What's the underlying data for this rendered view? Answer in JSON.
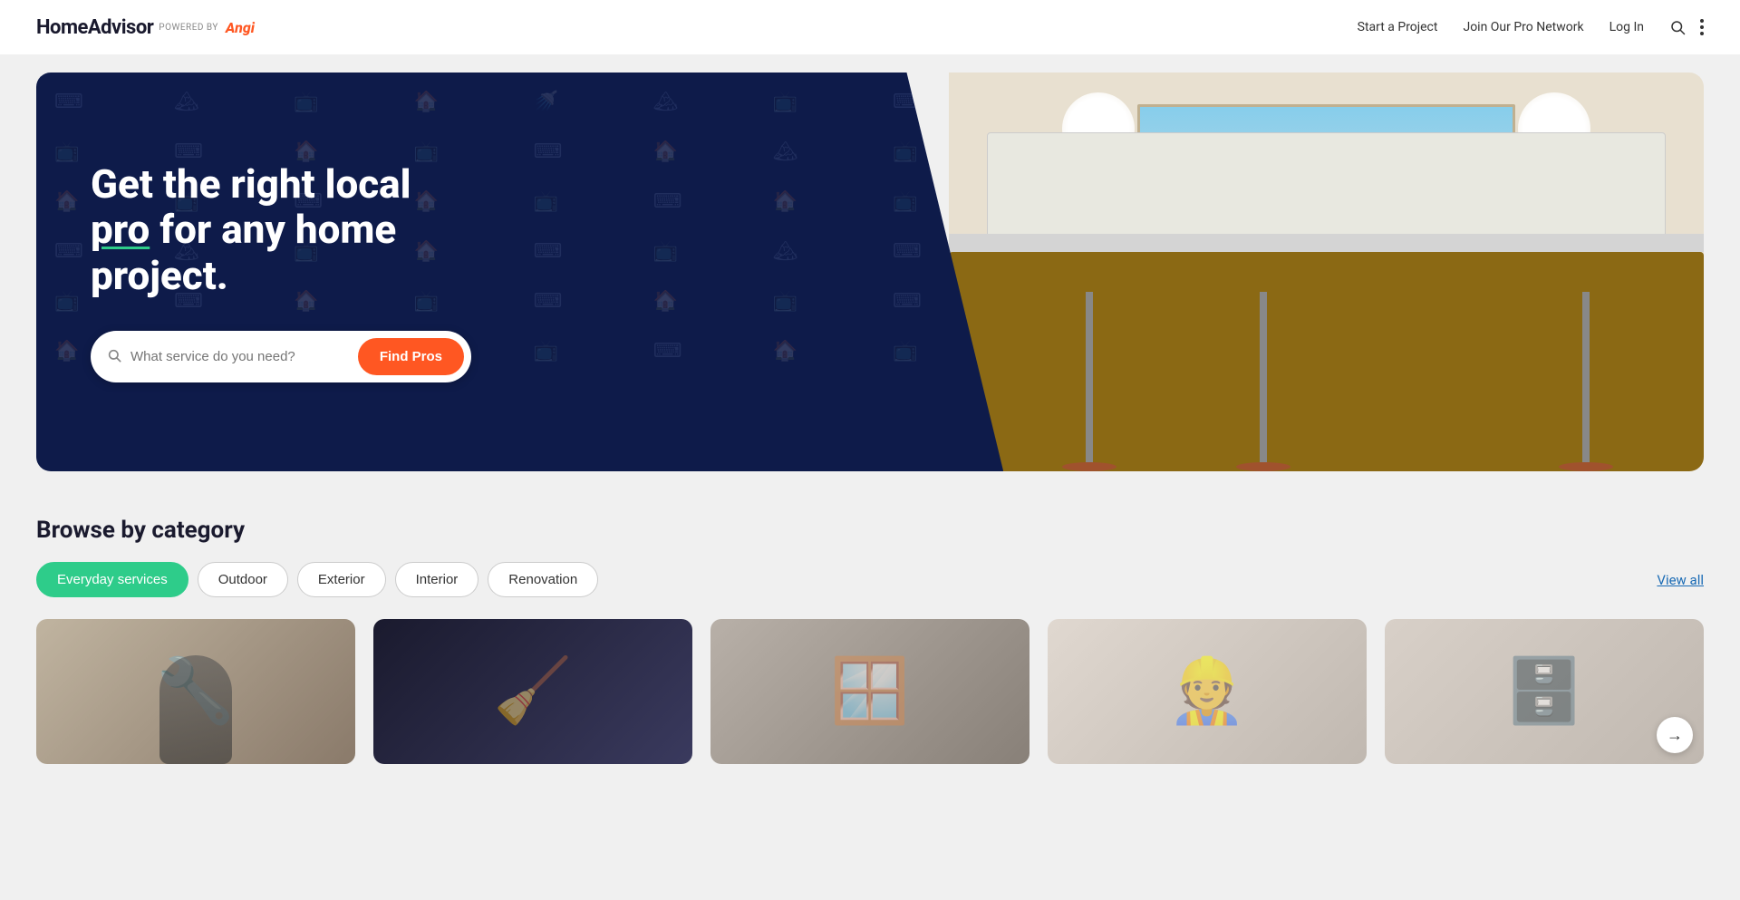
{
  "brand": {
    "logo_text": "HomeAdvisor",
    "powered_by": "POWERED BY",
    "angi": "Angi"
  },
  "navbar": {
    "links": [
      {
        "label": "Start a Project",
        "id": "start-project"
      },
      {
        "label": "Join Our Pro Network",
        "id": "join-pro"
      },
      {
        "label": "Log In",
        "id": "login"
      }
    ]
  },
  "hero": {
    "title_line1": "Get the right local",
    "title_highlight": "pro",
    "title_line2": "for any home",
    "title_line3": "project.",
    "search_placeholder": "What service do you need?",
    "find_pros_label": "Find Pros"
  },
  "browse": {
    "section_title": "Browse by category",
    "view_all_label": "View all",
    "tabs": [
      {
        "label": "Everyday services",
        "active": true
      },
      {
        "label": "Outdoor",
        "active": false
      },
      {
        "label": "Exterior",
        "active": false
      },
      {
        "label": "Interior",
        "active": false
      },
      {
        "label": "Renovation",
        "active": false
      }
    ]
  },
  "service_cards": [
    {
      "id": "card-1",
      "color_class": "card-bg-1",
      "emoji": "🔧"
    },
    {
      "id": "card-2",
      "color_class": "card-bg-2",
      "emoji": "🧹"
    },
    {
      "id": "card-3",
      "color_class": "card-bg-3",
      "emoji": "🪟"
    },
    {
      "id": "card-4",
      "color_class": "card-bg-4",
      "emoji": "👷"
    },
    {
      "id": "card-5",
      "color_class": "card-bg-5",
      "emoji": "🗄️"
    }
  ],
  "icons": {
    "search": "🔍",
    "more_vert": "⋮",
    "arrow_right": "→"
  }
}
